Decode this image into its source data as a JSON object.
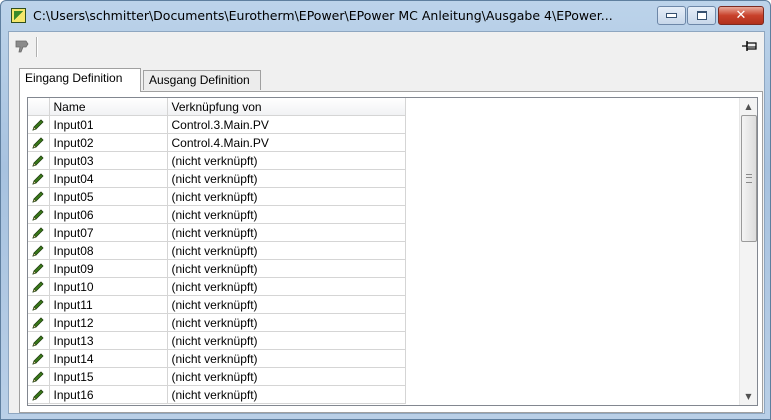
{
  "window": {
    "title": "C:\\Users\\schmitter\\Documents\\Eurotherm\\EPower\\EPower MC Anleitung\\Ausgabe 4\\EPower...",
    "close_label": "✕"
  },
  "tabs": [
    {
      "label": "Eingang Definition",
      "active": true
    },
    {
      "label": "Ausgang Definition",
      "active": false
    }
  ],
  "table": {
    "columns": [
      "",
      "Name",
      "Verknüpfung von"
    ],
    "rows": [
      {
        "name": "Input01",
        "link": "Control.3.Main.PV"
      },
      {
        "name": "Input02",
        "link": "Control.4.Main.PV"
      },
      {
        "name": "Input03",
        "link": "(nicht verknüpft)"
      },
      {
        "name": "Input04",
        "link": "(nicht verknüpft)"
      },
      {
        "name": "Input05",
        "link": "(nicht verknüpft)"
      },
      {
        "name": "Input06",
        "link": "(nicht verknüpft)"
      },
      {
        "name": "Input07",
        "link": "(nicht verknüpft)"
      },
      {
        "name": "Input08",
        "link": "(nicht verknüpft)"
      },
      {
        "name": "Input09",
        "link": "(nicht verknüpft)"
      },
      {
        "name": "Input10",
        "link": "(nicht verknüpft)"
      },
      {
        "name": "Input11",
        "link": "(nicht verknüpft)"
      },
      {
        "name": "Input12",
        "link": "(nicht verknüpft)"
      },
      {
        "name": "Input13",
        "link": "(nicht verknüpft)"
      },
      {
        "name": "Input14",
        "link": "(nicht verknüpft)"
      },
      {
        "name": "Input15",
        "link": "(nicht verknüpft)"
      },
      {
        "name": "Input16",
        "link": "(nicht verknüpft)"
      }
    ],
    "row_icon": "pencil-icon"
  },
  "colors": {
    "title_bar": "#bcd3ea",
    "close_button": "#c8412b",
    "pencil": "#3a7a1a"
  }
}
